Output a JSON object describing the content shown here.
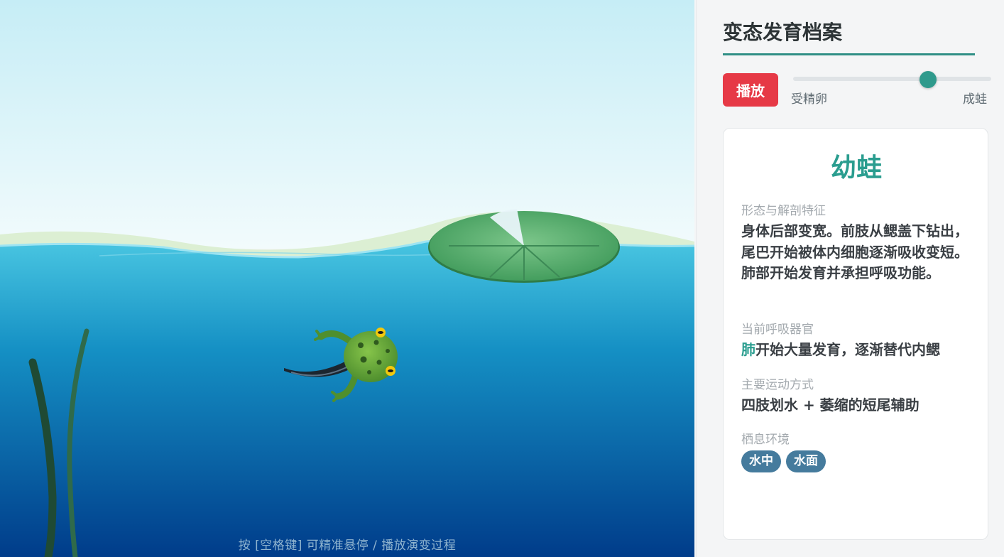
{
  "scene": {
    "hint": "按 [空格键] 可精准悬停 / 播放演变过程",
    "colors": {
      "sky_top": "#c9eef6",
      "sky_bottom": "#eaf8fb",
      "water_top": "#48c5e0",
      "water_bottom": "#003f8c",
      "lily": "#5fb374",
      "frog": "#6aab3c"
    }
  },
  "panel": {
    "title": "变态发育档案",
    "play_label": "播放",
    "slider": {
      "start_label": "受精卵",
      "end_label": "成蛙",
      "value": 0.68
    },
    "card": {
      "stage": "幼蛙",
      "morphology_label": "形态与解剖特征",
      "morphology_text": "身体后部变宽。前肢从鳃盖下钻出，尾巴开始被体内细胞逐渐吸收变短。肺部开始发育并承担呼吸功能。",
      "respiration_label": "当前呼吸器官",
      "respiration_organ": "肺",
      "respiration_text": "开始大量发育，逐渐替代内鳃",
      "movement_label": "主要运动方式",
      "movement_text": "四肢划水 + 萎缩的短尾辅助",
      "habitat_label": "栖息环境",
      "habitat_tags": [
        "水中",
        "水面"
      ]
    },
    "colors": {
      "accent": "#2a9d8f",
      "play": "#e63946",
      "tag": "#457b9d"
    }
  }
}
